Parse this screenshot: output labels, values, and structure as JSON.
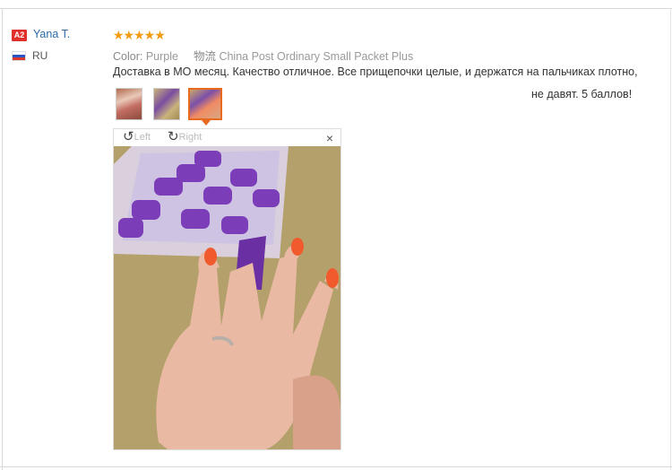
{
  "reviewer": {
    "badge": "A2",
    "name": "Yana T.",
    "country": "RU"
  },
  "review": {
    "stars": "★★★★★",
    "rating": 5,
    "color_label": "Color:",
    "color_value": "Purple",
    "shipping_label": "物流",
    "shipping_value": "China Post Ordinary Small Packet Plus",
    "text_line1": "Доставка в МО месяц. Качество отличное. Все прищепочки целые, и держатся на пальчиках плотно,",
    "text_line2": "не давят. 5 баллов!"
  },
  "thumbnails": [
    {
      "name": "photo-1",
      "active": false
    },
    {
      "name": "photo-2",
      "active": false
    },
    {
      "name": "photo-3",
      "active": true
    }
  ],
  "viewer": {
    "rotate_left": "Left",
    "rotate_right": "Right",
    "close": "×"
  },
  "icons": {
    "rotate_left": "rotate-left-icon",
    "rotate_right": "rotate-right-icon",
    "close": "close-icon",
    "flag": "russia-flag-icon"
  },
  "colors": {
    "accent": "#e86a1e",
    "link": "#2a6aa8",
    "badge": "#e0302a",
    "star": "#f39c12"
  }
}
